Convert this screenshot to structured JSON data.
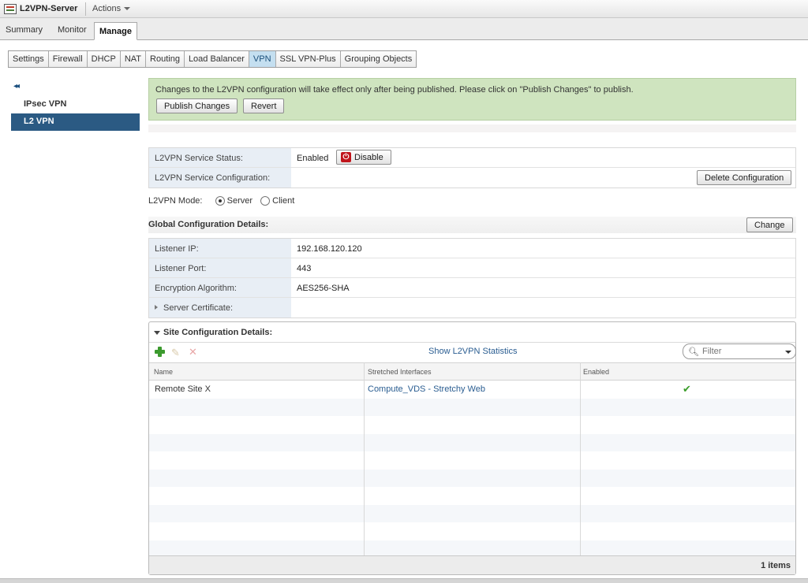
{
  "header": {
    "app_title": "L2VPN-Server",
    "actions_label": "Actions"
  },
  "main_tabs": [
    {
      "label": "Summary"
    },
    {
      "label": "Monitor"
    },
    {
      "label": "Manage",
      "active": true
    }
  ],
  "sub_tabs": [
    {
      "label": "Settings"
    },
    {
      "label": "Firewall"
    },
    {
      "label": "DHCP"
    },
    {
      "label": "NAT"
    },
    {
      "label": "Routing"
    },
    {
      "label": "Load Balancer"
    },
    {
      "label": "VPN",
      "active": true
    },
    {
      "label": "SSL VPN-Plus"
    },
    {
      "label": "Grouping Objects"
    }
  ],
  "left_nav": {
    "collapse_glyph": "◂◂",
    "items": [
      {
        "label": "IPsec VPN"
      },
      {
        "label": "L2 VPN",
        "selected": true
      }
    ]
  },
  "notice": {
    "text": "Changes to the L2VPN configuration will take effect only after being published. Please click on \"Publish Changes\" to publish.",
    "publish_label": "Publish Changes",
    "revert_label": "Revert"
  },
  "service": {
    "status_label": "L2VPN Service Status:",
    "status_value": "Enabled",
    "disable_label": "Disable",
    "config_label": "L2VPN Service Configuration:",
    "delete_label": "Delete Configuration"
  },
  "mode": {
    "label": "L2VPN Mode:",
    "server_label": "Server",
    "client_label": "Client",
    "selected": "Server"
  },
  "global": {
    "title": "Global Configuration Details:",
    "change_label": "Change",
    "rows": [
      {
        "label": "Listener IP:",
        "value": "192.168.120.120"
      },
      {
        "label": "Listener Port:",
        "value": "443"
      },
      {
        "label": "Encryption Algorithm:",
        "value": "AES256-SHA"
      },
      {
        "label": "Server Certificate:",
        "value": ""
      }
    ]
  },
  "site": {
    "title": "Site Configuration Details:",
    "stats_link": "Show L2VPN Statistics",
    "filter_placeholder": "Filter",
    "columns": [
      "Name",
      "Stretched Interfaces",
      "Enabled"
    ],
    "rows": [
      {
        "name": "Remote Site X",
        "interfaces": "Compute_VDS - Stretchy Web",
        "enabled": true
      }
    ],
    "item_count": "1 items"
  },
  "colors": {
    "accent": "#2b5a83",
    "notice_bg": "#cfe4bf",
    "link": "#2a5d91",
    "enabled_check": "#3b9d2a"
  }
}
